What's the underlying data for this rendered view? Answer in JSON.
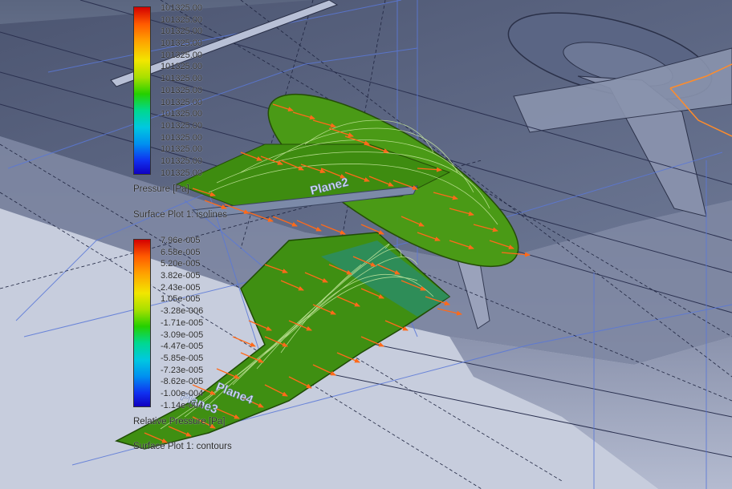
{
  "legend_pressure": {
    "values": [
      "101325.00",
      "101325.00",
      "101325.00",
      "101325.00",
      "101325.00",
      "101325.00",
      "101325.00",
      "101325.00",
      "101325.00",
      "101325.00",
      "101325.00",
      "101325.00",
      "101325.00",
      "101325.00",
      "101325.00"
    ],
    "quantity": "Pressure [Pa]",
    "plot_title": "Surface Plot 1: isolines"
  },
  "legend_relative_pressure": {
    "values": [
      "7.96e-005",
      "6.58e-005",
      "5.20e-005",
      "3.82e-005",
      "2.43e-005",
      "1.05e-005",
      "-3.28e-006",
      "-1.71e-005",
      "-3.09e-005",
      "-4.47e-005",
      "-5.85e-005",
      "-7.23e-005",
      "-8.62e-005",
      "-1.00e-004",
      "-1.14e-004"
    ],
    "quantity": "Relative Pressure [Pa]",
    "plot_title": "Surface Plot 1: contours"
  },
  "plane_labels": {
    "upper": "Plane2",
    "lower_front": "Plane3",
    "lower_back": "Plane4"
  },
  "colors": {
    "surface_green": "#3f9a14",
    "arrow_orange": "#ff6a1a",
    "isoline": "#c8e8a0",
    "background": "#9aa5bd"
  }
}
